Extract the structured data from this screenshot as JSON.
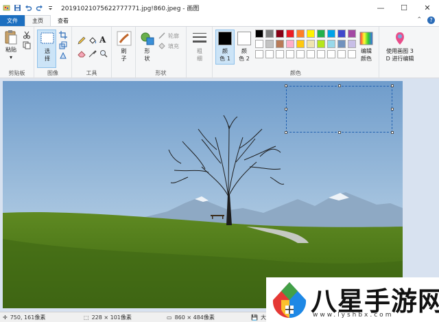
{
  "titlebar": {
    "title": "20191021075622777771.jpg!860.jpeg - 画图",
    "minimize": "—",
    "maximize": "☐",
    "close": "✕"
  },
  "tabs": [
    {
      "label": "文件"
    },
    {
      "label": "主页"
    },
    {
      "label": "查看"
    }
  ],
  "help": {
    "collapse": "⌃",
    "help": "?"
  },
  "ribbon": {
    "clipboard": {
      "paste": "粘贴",
      "group": "剪贴板"
    },
    "image": {
      "select_line1": "选",
      "select_line2": "择",
      "group": "图像"
    },
    "tools": {
      "group": "工具",
      "text_glyph": "A"
    },
    "brush": {
      "line1": "刷",
      "line2": "子"
    },
    "shapes": {
      "shapes_line1": "形",
      "shapes_line2": "状",
      "outline": "轮廓",
      "fill": "填充",
      "group": "形状"
    },
    "size": {
      "line1": "粗",
      "line2": "细"
    },
    "colors": {
      "color1_line1": "颜",
      "color1_line2": "色 1",
      "color2_line1": "颜",
      "color2_line2": "色 2",
      "edit_line1": "编辑",
      "edit_line2": "颜色",
      "group": "颜色",
      "color1_value": "#000000",
      "color2_value": "#ffffff",
      "palette": [
        "#000000",
        "#7f7f7f",
        "#880015",
        "#ed1c24",
        "#ff7f27",
        "#fff200",
        "#22b14c",
        "#00a2e8",
        "#3f48cc",
        "#a349a4",
        "#ffffff",
        "#c3c3c3",
        "#b97a57",
        "#ffaec9",
        "#ffc90e",
        "#efe4b0",
        "#b5e61d",
        "#99d9ea",
        "#7092be",
        "#c8bfe7",
        "#ffffff",
        "#ffffff",
        "#ffffff",
        "#ffffff",
        "#ffffff",
        "#ffffff",
        "#ffffff",
        "#ffffff",
        "#ffffff",
        "#ffffff"
      ]
    },
    "paint3d": {
      "line1": "使用画图 3",
      "line2": "D 进行编辑"
    }
  },
  "status": {
    "cursor": "750, 161像素",
    "selection": "228 × 101像素",
    "image_size": "860 × 484像素",
    "file_size": "大小"
  },
  "watermark": {
    "text": "八星手游网",
    "url": "www.lyshbx.com"
  }
}
